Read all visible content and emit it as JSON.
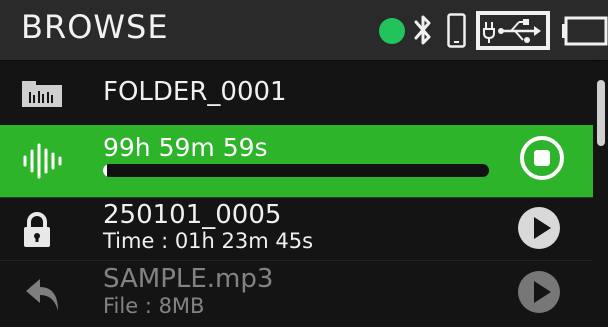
{
  "header": {
    "title": "BROWSE",
    "status_dot_color": "#21c35a",
    "icons": [
      "status-dot-icon",
      "bluetooth-icon",
      "phone-icon",
      "usb-icon",
      "battery-icon"
    ]
  },
  "list": {
    "folder": {
      "name": "FOLDER_0001",
      "icon": "folder-icon"
    },
    "recording": {
      "time": "99h 59m 59s",
      "progress": 0.01,
      "accent": "#2db42a",
      "icon": "waveform-icon",
      "button": "stop-icon"
    },
    "file1": {
      "name": "250101_0005",
      "detail": "Time : 01h 23m 45s",
      "icon": "lock-icon",
      "button": "play-icon"
    },
    "file2": {
      "name": "SAMPLE.mp3",
      "detail": "File : 8MB",
      "icon": "back-arrow-icon",
      "button": "play-icon"
    }
  }
}
